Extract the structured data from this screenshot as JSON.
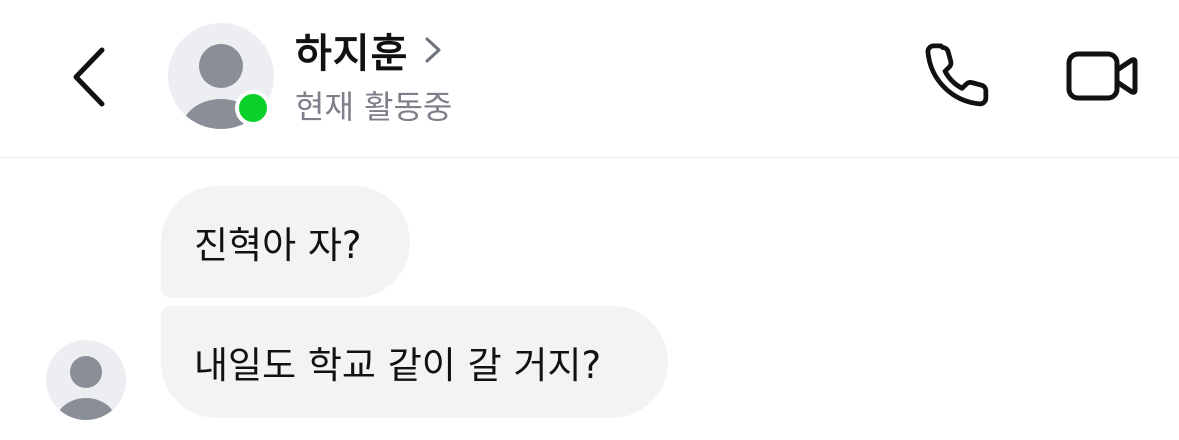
{
  "header": {
    "contact_name": "하지훈",
    "status_text": "현재 활동중"
  },
  "icons": {
    "back": "chevron-left-icon",
    "name_chevron": "chevron-right-icon",
    "call": "phone-icon",
    "video": "video-camera-icon"
  },
  "colors": {
    "online": "#0ad12a",
    "bubble": "#f2f3f5",
    "status_text": "#7d8088",
    "avatar_bg": "#eceef1",
    "avatar_figure": "#8a8e97"
  },
  "messages": [
    {
      "text": "진혁아 자?"
    },
    {
      "text": "내일도 학교 같이 갈 거지?"
    }
  ]
}
